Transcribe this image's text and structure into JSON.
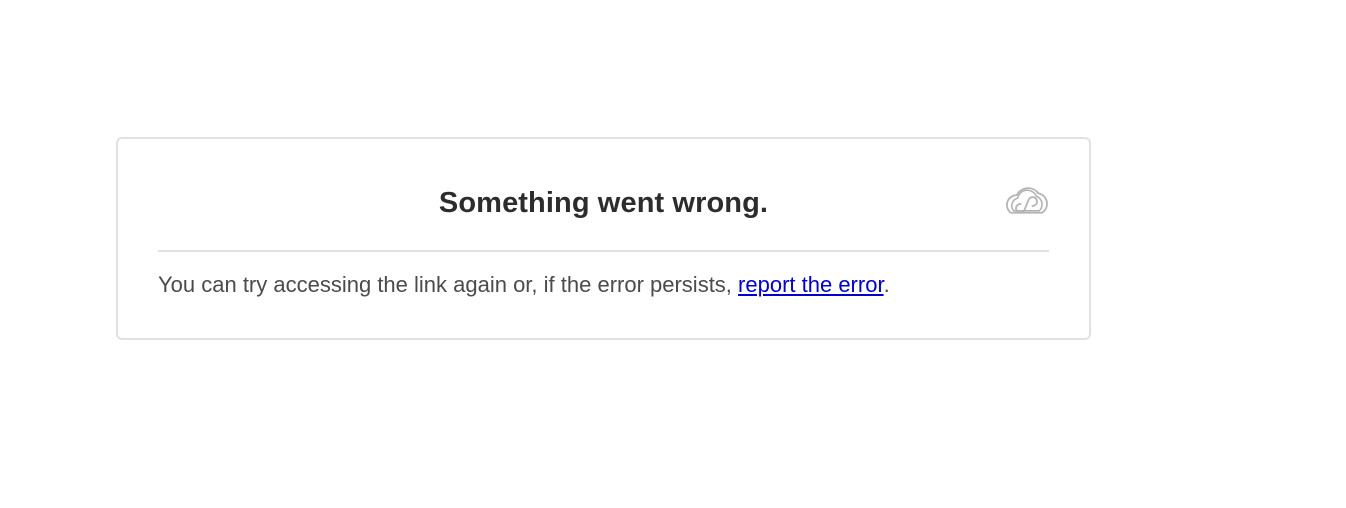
{
  "error": {
    "title": "Something went wrong.",
    "message_prefix": "You can try accessing the link again or, if the error persists, ",
    "link_text": "report the error",
    "message_suffix": ".",
    "logo_icon": "creative-cloud-icon"
  },
  "colors": {
    "link": "#0000cc",
    "border": "#e1e1e1",
    "title": "#2c2c2c",
    "text": "#4b4b4b",
    "logo": "#b3b3b3"
  }
}
